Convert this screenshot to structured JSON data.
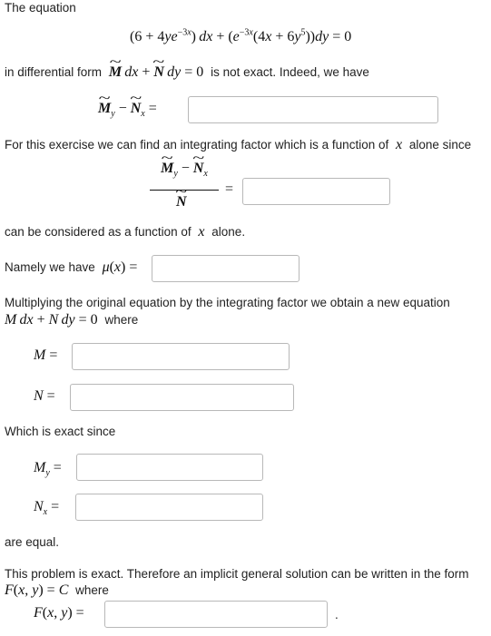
{
  "intro": "The equation",
  "sentence_nonexact_before": "in differential form",
  "sentence_nonexact_after": "is not exact. Indeed, we have",
  "sentence_factor": "For this exercise we can find an integrating factor which is a function of",
  "sentence_factor_tail": "alone since",
  "sentence_function_before": "can be considered as a function of",
  "sentence_function_after": "alone.",
  "sentence_namely": "Namely we have",
  "sentence_multiplying": "Multiplying the original equation by the integrating factor we obtain a new equation",
  "sentence_where": "where",
  "sentence_exact_since": "Which is exact since",
  "sentence_are_equal": "are equal.",
  "sentence_implicit": "This problem is exact. Therefore an implicit general solution can be written in the form",
  "sentence_where_2": "where",
  "trailing_period": ".",
  "inputs": {
    "my_minus_nx": "",
    "ratio": "",
    "mu": "",
    "M": "",
    "N": "",
    "My": "",
    "Nx": "",
    "F": ""
  }
}
